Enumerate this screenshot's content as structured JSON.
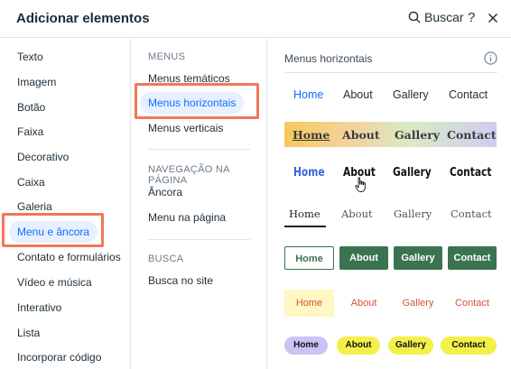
{
  "header": {
    "title": "Adicionar elementos",
    "search_label": "Buscar",
    "help_label": "?"
  },
  "categories": [
    {
      "label": "Texto"
    },
    {
      "label": "Imagem"
    },
    {
      "label": "Botão"
    },
    {
      "label": "Faixa"
    },
    {
      "label": "Decorativo"
    },
    {
      "label": "Caixa"
    },
    {
      "label": "Galeria"
    },
    {
      "label": "Menu e âncora",
      "active": true
    },
    {
      "label": "Contato e formulários"
    },
    {
      "label": "Vídeo e música"
    },
    {
      "label": "Interativo"
    },
    {
      "label": "Lista"
    },
    {
      "label": "Incorporar código"
    }
  ],
  "subnav": {
    "menus": {
      "title": "MENUS",
      "items": [
        "Menus temáticos",
        "Menus horizontais",
        "Menus verticais"
      ],
      "active": "Menus horizontais"
    },
    "navigation": {
      "title": "NAVEGAÇÃO NA PÁGINA",
      "items": [
        "Âncora",
        "Menu na página"
      ]
    },
    "search": {
      "title": "BUSCA",
      "items": [
        "Busca no site"
      ]
    }
  },
  "panel": {
    "title": "Menus horizontais",
    "menu_items": [
      "Home",
      "About",
      "Gallery",
      "Contact"
    ]
  },
  "colors": {
    "accent": "#116dff",
    "highlight_border": "#f0775a",
    "green": "#3b7350",
    "yellow_pill": "#f3f04a",
    "lavender_pill": "#c9c4f5",
    "coral_text": "#d3533d"
  }
}
